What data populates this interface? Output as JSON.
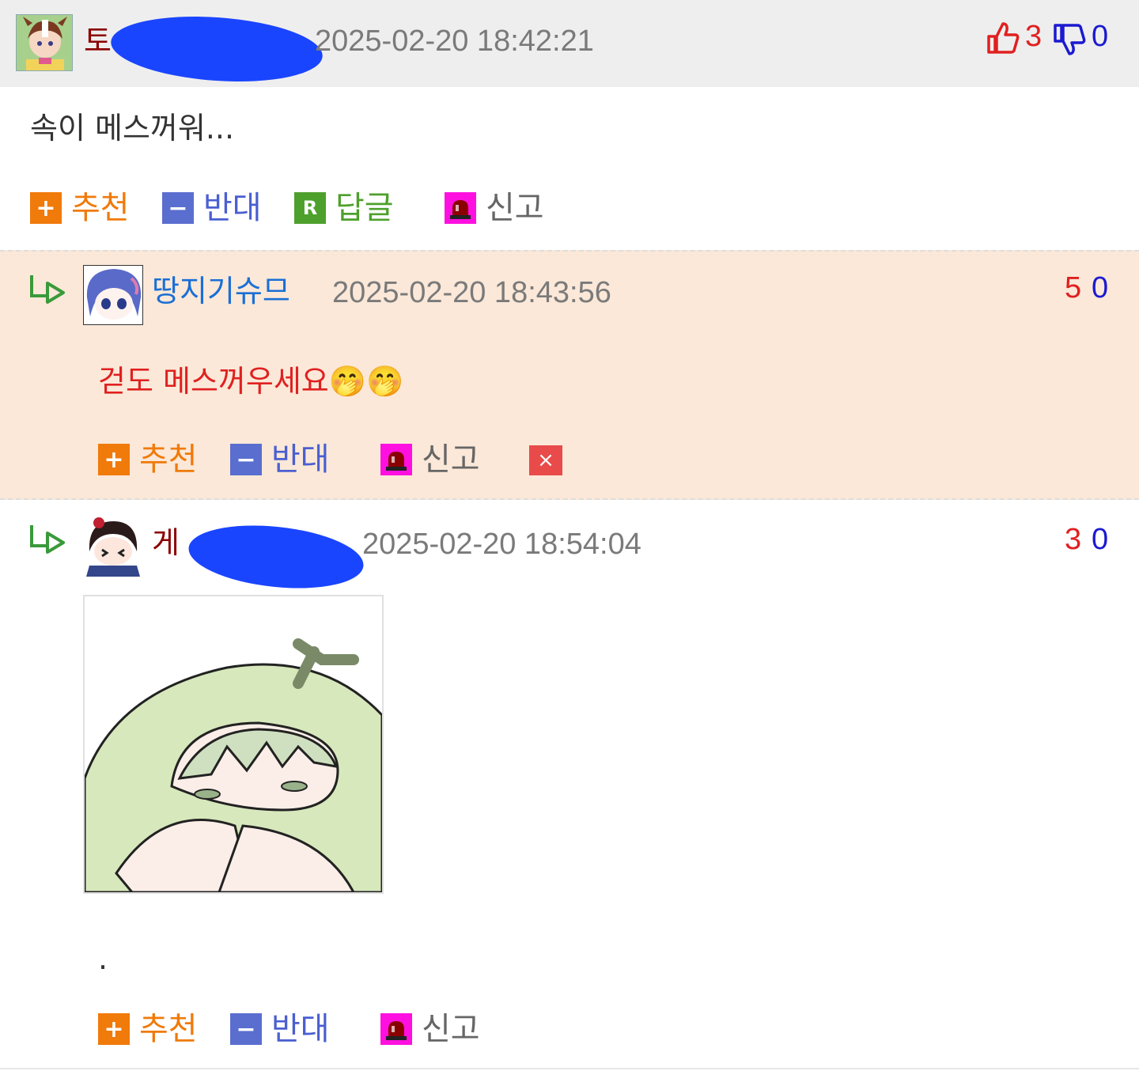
{
  "comments": [
    {
      "author": "토",
      "timestamp": "2025-02-20 18:42:21",
      "upvotes": "3",
      "downvotes": "0",
      "text": "속이 메스꺼워...",
      "actions": {
        "recommend": "추천",
        "oppose": "반대",
        "reply": "답글",
        "report": "신고"
      },
      "icons": {
        "up": "thumbs-up-icon",
        "down": "thumbs-down-icon"
      }
    },
    {
      "author": "땅지기슈므",
      "timestamp": "2025-02-20 18:43:56",
      "upvotes": "5",
      "downvotes": "0",
      "text": "걷도 메스꺼우세요🤭🤭",
      "actions": {
        "recommend": "추천",
        "oppose": "반대",
        "report": "신고",
        "delete": "×"
      }
    },
    {
      "author": "게",
      "timestamp": "2025-02-20 18:54:04",
      "upvotes": "3",
      "downvotes": "0",
      "text": ".",
      "actions": {
        "recommend": "추천",
        "oppose": "반대",
        "report": "신고"
      }
    }
  ],
  "colors": {
    "header_bg": "#eeeeee",
    "reply_bg": "#fbe8d8",
    "author1": "#8b0000",
    "author2": "#1a6fd6",
    "author3": "#8b0000",
    "reply_text": "#e02020",
    "redaction": "#1a45ff"
  }
}
